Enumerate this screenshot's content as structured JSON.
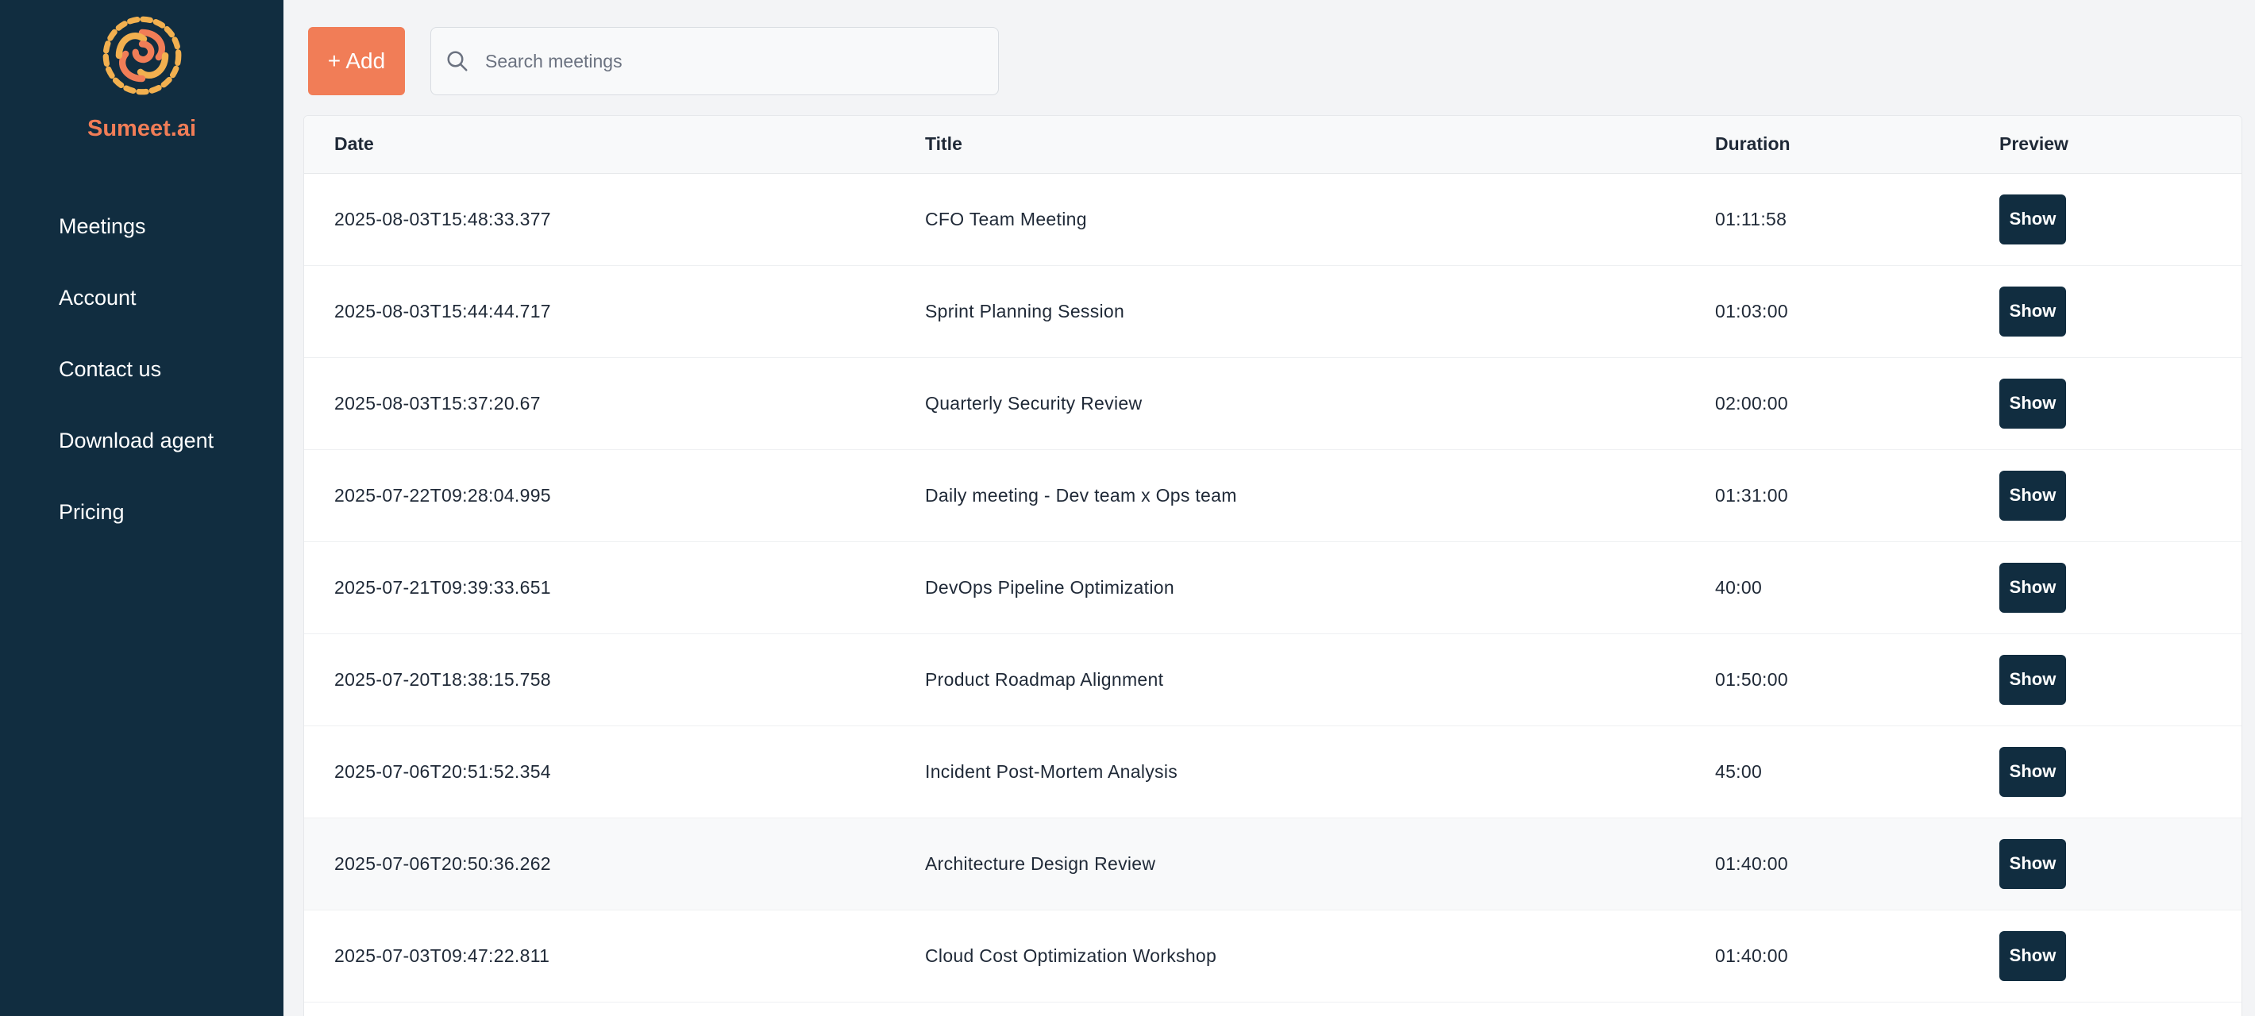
{
  "brand": {
    "name": "Sumeet.ai",
    "logo_icon": "swirl-logo-icon",
    "accent": "#f17d57",
    "sidebar_bg": "#112d40"
  },
  "nav": {
    "items": [
      {
        "label": "Meetings"
      },
      {
        "label": "Account"
      },
      {
        "label": "Contact us"
      },
      {
        "label": "Download agent"
      },
      {
        "label": "Pricing"
      }
    ]
  },
  "toolbar": {
    "add_label": "+ Add"
  },
  "search": {
    "placeholder": "Search meetings",
    "value": "",
    "icon": "search-icon"
  },
  "table": {
    "headers": {
      "date": "Date",
      "title": "Title",
      "duration": "Duration",
      "preview": "Preview"
    },
    "show_label": "Show",
    "rows": [
      {
        "date": "2025-08-03T15:48:33.377",
        "title": "CFO Team Meeting",
        "duration": "01:11:58"
      },
      {
        "date": "2025-08-03T15:44:44.717",
        "title": "Sprint Planning Session",
        "duration": "01:03:00"
      },
      {
        "date": "2025-08-03T15:37:20.67",
        "title": "Quarterly Security Review",
        "duration": "02:00:00"
      },
      {
        "date": "2025-07-22T09:28:04.995",
        "title": "Daily meeting - Dev team x Ops team",
        "duration": "01:31:00"
      },
      {
        "date": "2025-07-21T09:39:33.651",
        "title": "DevOps Pipeline Optimization",
        "duration": "40:00"
      },
      {
        "date": "2025-07-20T18:38:15.758",
        "title": "Product Roadmap Alignment",
        "duration": "01:50:00"
      },
      {
        "date": "2025-07-06T20:51:52.354",
        "title": "Incident Post-Mortem Analysis",
        "duration": "45:00"
      },
      {
        "date": "2025-07-06T20:50:36.262",
        "title": "Architecture Design Review",
        "duration": "01:40:00"
      },
      {
        "date": "2025-07-03T09:47:22.811",
        "title": "Cloud Cost Optimization Workshop",
        "duration": "01:40:00"
      }
    ]
  }
}
